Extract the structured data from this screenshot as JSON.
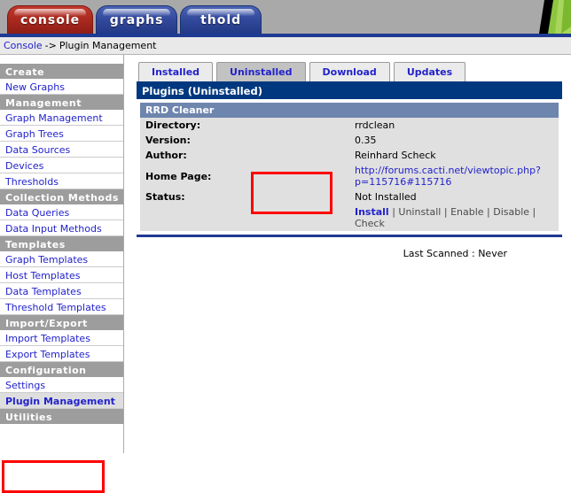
{
  "topnav": {
    "tabs": [
      {
        "label": "console",
        "style": "console"
      },
      {
        "label": "graphs",
        "style": "blue"
      },
      {
        "label": "thold",
        "style": "blue"
      }
    ],
    "logo_icon": "cacti-leaf-logo"
  },
  "breadcrumb": {
    "root_label": "Console",
    "separator": "->",
    "current": "Plugin Management"
  },
  "sidebar": {
    "sections": [
      {
        "header": "Create",
        "items": [
          {
            "label": "New Graphs",
            "selected": false
          }
        ]
      },
      {
        "header": "Management",
        "items": [
          {
            "label": "Graph Management",
            "selected": false
          },
          {
            "label": "Graph Trees",
            "selected": false
          },
          {
            "label": "Data Sources",
            "selected": false
          },
          {
            "label": "Devices",
            "selected": false
          },
          {
            "label": "Thresholds",
            "selected": false
          }
        ]
      },
      {
        "header": "Collection Methods",
        "items": [
          {
            "label": "Data Queries",
            "selected": false
          },
          {
            "label": "Data Input Methods",
            "selected": false
          }
        ]
      },
      {
        "header": "Templates",
        "items": [
          {
            "label": "Graph Templates",
            "selected": false
          },
          {
            "label": "Host Templates",
            "selected": false
          },
          {
            "label": "Data Templates",
            "selected": false
          },
          {
            "label": "Threshold Templates",
            "selected": false
          }
        ]
      },
      {
        "header": "Import/Export",
        "items": [
          {
            "label": "Import Templates",
            "selected": false
          },
          {
            "label": "Export Templates",
            "selected": false
          }
        ]
      },
      {
        "header": "Configuration",
        "items": [
          {
            "label": "Settings",
            "selected": false
          },
          {
            "label": "Plugin Management",
            "selected": true
          }
        ]
      },
      {
        "header": "Utilities",
        "items": []
      }
    ]
  },
  "content": {
    "tabs": [
      {
        "label": "Installed",
        "active": false
      },
      {
        "label": "Uninstalled",
        "active": true
      },
      {
        "label": "Download",
        "active": false
      },
      {
        "label": "Updates",
        "active": false
      }
    ],
    "panel_title": "Plugins (Uninstalled)",
    "plugin": {
      "name": "RRD Cleaner",
      "rows": [
        {
          "label": "Directory:",
          "value": "rrdclean",
          "is_link": false
        },
        {
          "label": "Version:",
          "value": "0.35",
          "is_link": false
        },
        {
          "label": "Author:",
          "value": "Reinhard Scheck",
          "is_link": false
        },
        {
          "label": "Home Page:",
          "value": "http://forums.cacti.net/viewtopic.php?p=115716#115716",
          "is_link": true
        },
        {
          "label": "Status:",
          "value": "Not Installed",
          "is_link": false
        }
      ],
      "actions": {
        "enabled": "Install",
        "disabled": [
          "Uninstall",
          "Enable",
          "Disable",
          "Check"
        ],
        "separator": "|"
      }
    },
    "last_scanned": "Last Scanned : Never"
  },
  "colors": {
    "accent_blue": "#1f3a93",
    "panel_header": "#00387f",
    "link": "#2222cc",
    "annotation_red": "#ff0000",
    "sidebar_header": "#9d9d9d"
  }
}
